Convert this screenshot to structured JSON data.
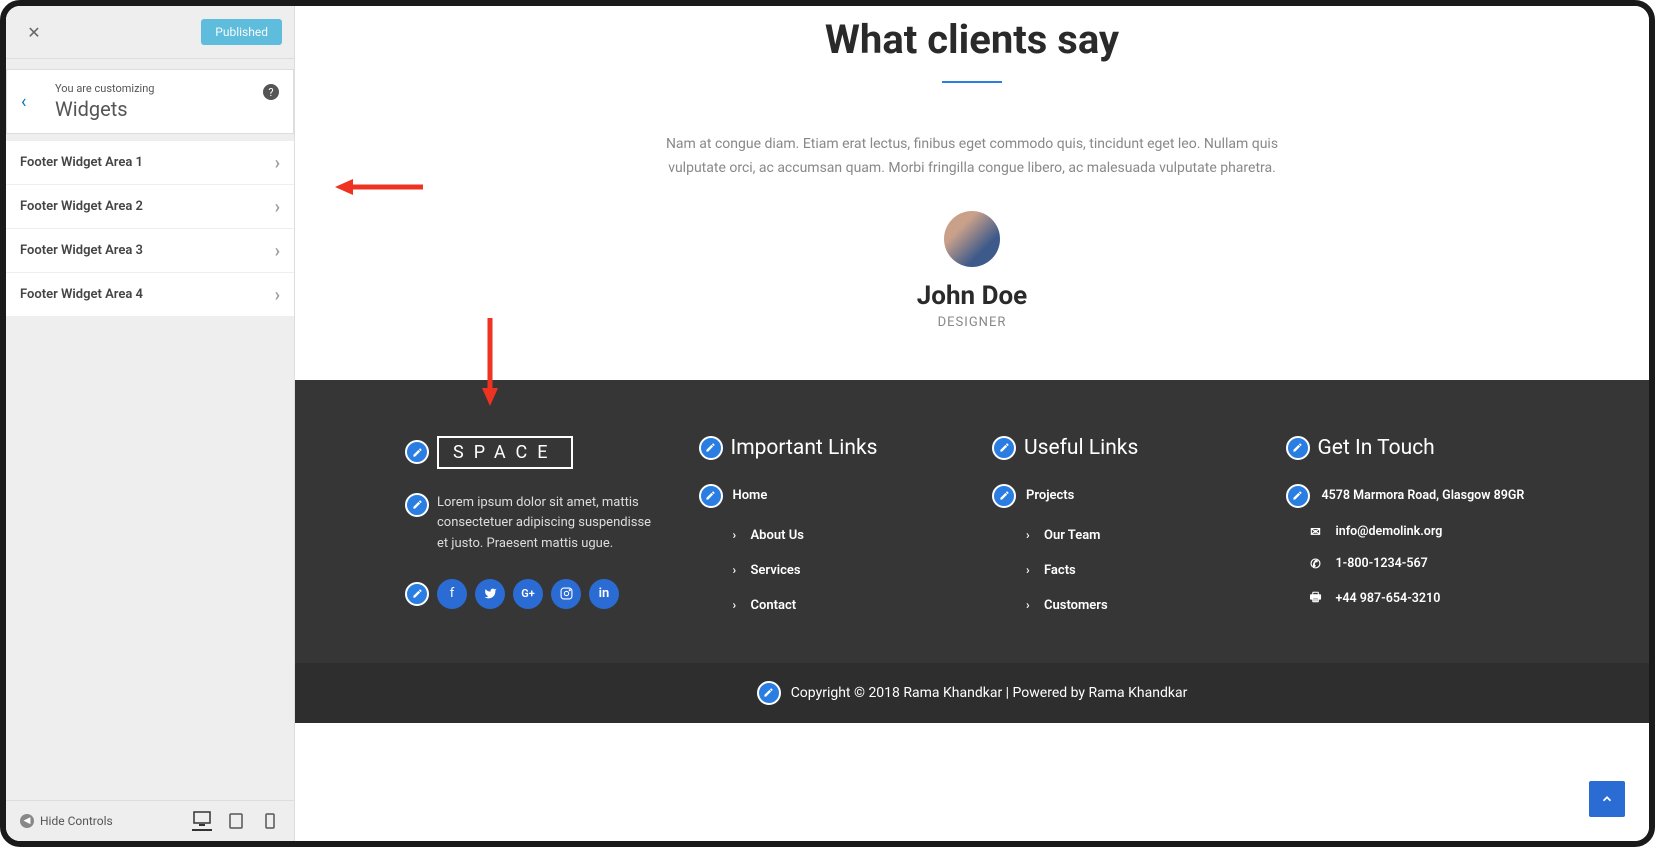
{
  "sidebar": {
    "published_label": "Published",
    "customizing_label": "You are customizing",
    "panel_title": "Widgets",
    "items": [
      {
        "label": "Footer Widget Area 1"
      },
      {
        "label": "Footer Widget Area 2"
      },
      {
        "label": "Footer Widget Area 3"
      },
      {
        "label": "Footer Widget Area 4"
      }
    ],
    "hide_controls": "Hide Controls"
  },
  "testimonial": {
    "heading": "What clients say",
    "text": "Nam at congue diam. Etiam erat lectus, finibus eget commodo quis, tincidunt eget leo. Nullam quis vulputate orci, ac accumsan quam. Morbi fringilla congue libero, ac malesuada vulputate pharetra.",
    "name": "John Doe",
    "role": "DESIGNER"
  },
  "footer": {
    "logo_text": "SPACE",
    "about_text": "Lorem ipsum dolor sit amet, mattis consectetuer adipiscing suspendisse et justo. Praesent mattis ugue.",
    "col2_title": "Important Links",
    "col2_links": [
      "Home",
      "About Us",
      "Services",
      "Contact"
    ],
    "col3_title": "Useful Links",
    "col3_links": [
      "Projects",
      "Our Team",
      "Facts",
      "Customers"
    ],
    "col4_title": "Get In Touch",
    "address": "4578 Marmora Road, Glasgow 89GR",
    "email": "info@demolink.org",
    "phone": "1-800-1234-567",
    "fax": "+44 987-654-3210"
  },
  "copyright": "Copyright © 2018 Rama Khandkar | Powered by Rama Khandkar"
}
